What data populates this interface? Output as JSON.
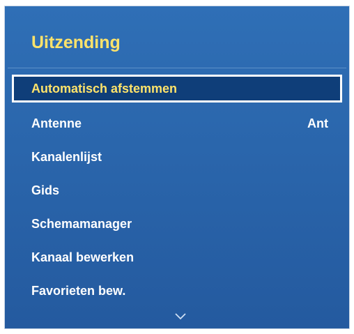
{
  "menu": {
    "title": "Uitzending",
    "items": [
      {
        "label": "Automatisch afstemmen",
        "value": ""
      },
      {
        "label": "Antenne",
        "value": "Ant"
      },
      {
        "label": "Kanalenlijst",
        "value": ""
      },
      {
        "label": "Gids",
        "value": ""
      },
      {
        "label": "Schemamanager",
        "value": ""
      },
      {
        "label": "Kanaal bewerken",
        "value": ""
      },
      {
        "label": "Favorieten bew.",
        "value": ""
      }
    ],
    "selected_index": 0
  },
  "icons": {
    "scroll_more": "chevron-down-icon"
  },
  "colors": {
    "panel_background": "#2a66ad",
    "title_text": "#ffe36a",
    "selected_background": "#0f3e79",
    "selected_border": "#ffffff",
    "selected_text": "#ffe36a",
    "item_text": "#ffffff"
  }
}
